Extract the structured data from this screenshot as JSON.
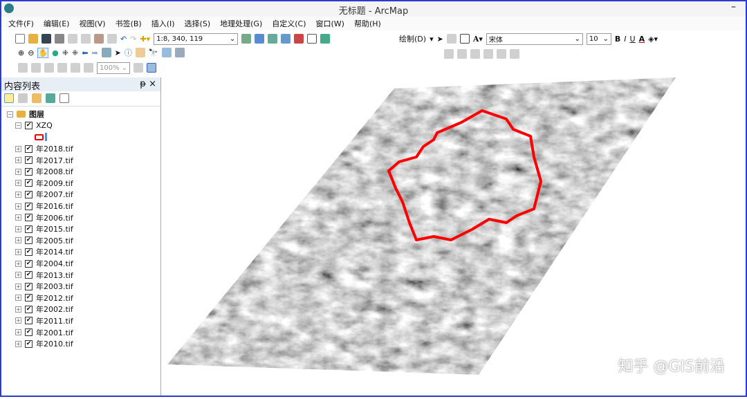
{
  "window": {
    "title": "无标题 - ArcMap"
  },
  "menu": [
    "文件(F)",
    "编辑(E)",
    "视图(V)",
    "书签(B)",
    "插入(I)",
    "选择(S)",
    "地理处理(G)",
    "自定义(C)",
    "窗口(W)",
    "帮助(H)"
  ],
  "toolbar": {
    "scale": "1:8, 340, 119",
    "zoom_pct": "100%",
    "draw_label": "绘制(D)",
    "font": "宋体",
    "font_size": "10",
    "bold": "B",
    "italic": "I",
    "underline": "U",
    "font_color": "A"
  },
  "toc": {
    "title": "内容列表",
    "pin": "ᵽ",
    "close": "×",
    "root": "图层",
    "layers": [
      "XZQ",
      "年2018.tif",
      "年2017.tif",
      "年2008.tif",
      "年2009.tif",
      "年2007.tif",
      "年2016.tif",
      "年2006.tif",
      "年2015.tif",
      "年2005.tif",
      "年2014.tif",
      "年2004.tif",
      "年2013.tif",
      "年2003.tif",
      "年2012.tif",
      "年2002.tif",
      "年2011.tif",
      "年2001.tif",
      "年2010.tif"
    ]
  },
  "colors": {
    "boundary": "#ff0000",
    "accent": "#2a3bd0"
  },
  "watermark": "知乎 @GIS前沿"
}
